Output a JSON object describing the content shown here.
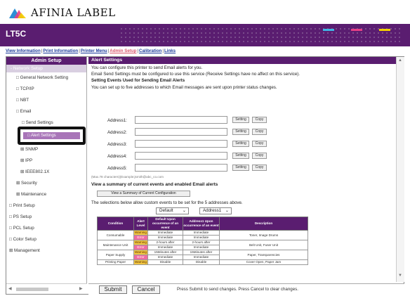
{
  "brand": {
    "name": "AFINIA LABEL",
    "colors": [
      "#e83f86",
      "#2d8fd5",
      "#f4d000"
    ]
  },
  "printer": {
    "model": "LT5C",
    "accent": "#5a1d70"
  },
  "nav": {
    "links": [
      "View Information",
      "Print Information",
      "Printer Menu",
      "Admin Setup",
      "Calibration",
      "Links"
    ],
    "active": "Admin Setup"
  },
  "sidebar": {
    "header": "Admin Setup",
    "section": "Network Setup",
    "items": [
      "General Network Setting",
      "TCP/IP",
      "NBT",
      "Email",
      "Send Settings",
      "Alert Settings",
      "SNMP",
      "IPP",
      "IEEE802.1X",
      "Security",
      "Maintenance",
      "Print Setup",
      "PS Setup",
      "PCL Setup",
      "Color Setup",
      "Management"
    ]
  },
  "alert": {
    "section_title": "Alert Settings",
    "intro": "You can configure this printer to send Email alerts for you.",
    "note": "Email Send Settings must be configured to use this service (Receive Settings have no affect on this service).",
    "events_heading": "Setting Events Used for Sending Email Alerts",
    "events_desc": "You can set up to five addresses to which Email messages are sent upon printer status changes.",
    "addresses": [
      {
        "label": "Address1:",
        "value": ""
      },
      {
        "label": "Address2:",
        "value": ""
      },
      {
        "label": "Address3:",
        "value": ""
      },
      {
        "label": "Address4:",
        "value": ""
      },
      {
        "label": "Address5:",
        "value": ""
      }
    ],
    "setting_label": "Setting",
    "copy_label": "Copy",
    "hint": "(Max.78 characters)(Example:jsmith@abc_co.com",
    "summary_heading": "View a summary of current events and enabled Email alerts",
    "summary_button": "View a Summary of Current Configuration",
    "selection_text": "The selections below allow custom events to be set for the 5 addresses above.",
    "select_default": "Default",
    "select_address": "Address1"
  },
  "event_table": {
    "headers": [
      "Condition",
      "Alert Level",
      "Default Upon occurrence of an event",
      "Address1 Upon occurrence of an event",
      "Description"
    ],
    "rows": [
      {
        "condition": "Consumable",
        "levels": [
          "Warning",
          "Error"
        ],
        "def": [
          "Immediate",
          "Immediate"
        ],
        "addr": [
          "Immediate",
          "Immediate"
        ],
        "desc": "Toner, Image Drums"
      },
      {
        "condition": "Maintenance Unit",
        "levels": [
          "Warning",
          "Error"
        ],
        "def": [
          "2-hours after",
          "Immediate"
        ],
        "addr": [
          "2-hours after",
          "Immediate"
        ],
        "desc": "Belt Unit, Fuser Unit"
      },
      {
        "condition": "Paper Supply",
        "levels": [
          "Warning",
          "Error"
        ],
        "def": [
          "15Minutes after",
          "Immediate"
        ],
        "addr": [
          "15Minutes after",
          "Immediate"
        ],
        "desc": "Paper, Transparencies"
      },
      {
        "condition": "Printing Paper",
        "levels": [
          "Warning",
          ""
        ],
        "def": [
          "Disable",
          ""
        ],
        "addr": [
          "Disable",
          ""
        ],
        "desc": "Cover Open, Paper Jam"
      }
    ]
  },
  "footer": {
    "submit": "Submit",
    "cancel": "Cancel",
    "message": "Press Submit to send changes. Press Cancel to clear changes."
  }
}
